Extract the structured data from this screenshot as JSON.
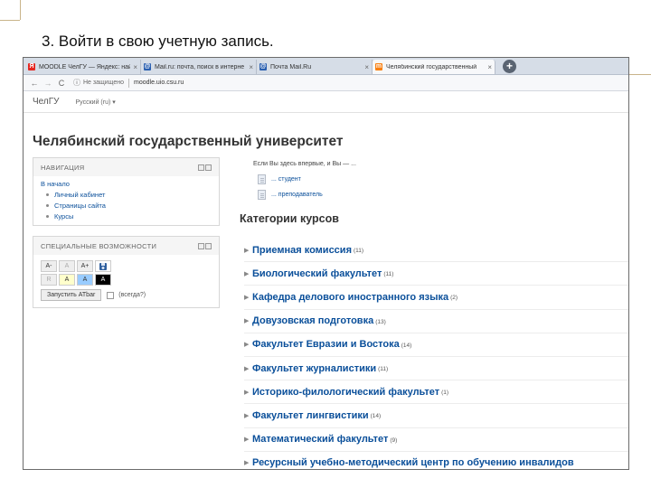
{
  "slide": {
    "title": "3. Войти в свою учетную запись."
  },
  "browser": {
    "tabs": [
      {
        "favicon": "Я",
        "favicon_color": "#e52620",
        "title": "MOODLE ЧелГУ — Яндекс: най",
        "active": false
      },
      {
        "favicon": "@",
        "favicon_color": "#2a5fb0",
        "title": "Mail.ru: почта, поиск в интерне",
        "active": false
      },
      {
        "favicon": "@",
        "favicon_color": "#2a5fb0",
        "title": "Почта Mail.Ru",
        "active": false
      },
      {
        "favicon": "m",
        "favicon_color": "#f98012",
        "title": "Челябинский государственный",
        "active": true
      }
    ],
    "close_glyph": "×",
    "new_tab_glyph": "+",
    "back_glyph": "←",
    "forward_glyph": "→",
    "reload_glyph": "C",
    "info_glyph": "ⓘ",
    "security_label": "Не защищено",
    "url": "moodle.uio.csu.ru"
  },
  "site": {
    "brand": "ЧелГУ",
    "language": "Русский (ru) ▾",
    "page_title": "Челябинский государственный университет"
  },
  "navigation_block": {
    "heading": "НАВИГАЦИЯ",
    "home": "В начало",
    "items": [
      "Личный кабинет",
      "Страницы сайта",
      "Курсы"
    ]
  },
  "accessibility_block": {
    "heading": "СПЕЦИАЛЬНЫЕ ВОЗМОЖНОСТИ",
    "row1": [
      {
        "label": "A-",
        "bg": "#eeeeee",
        "fg": "#333333"
      },
      {
        "label": "A",
        "bg": "#eeeeee",
        "fg": "#aaaaaa"
      },
      {
        "label": "A+",
        "bg": "#eeeeee",
        "fg": "#333333"
      },
      {
        "label": "",
        "bg": "#ffffff",
        "fg": "#333333",
        "icon": "save-icon"
      }
    ],
    "row2": [
      {
        "label": "R",
        "bg": "#eeeeee",
        "fg": "#aaaaaa"
      },
      {
        "label": "A",
        "bg": "#ffffcc",
        "fg": "#333333"
      },
      {
        "label": "A",
        "bg": "#99ccff",
        "fg": "#333333"
      },
      {
        "label": "A",
        "bg": "#000000",
        "fg": "#ffffff"
      }
    ],
    "atbar_button": "Запустить ATbar",
    "always_label": "(всегда?)"
  },
  "main": {
    "welcome": "Если Вы здесь впервые, и Вы — ...",
    "roles": [
      "... студент",
      "... преподаватель"
    ],
    "categories_heading": "Категории курсов",
    "categories": [
      {
        "name": "Приемная комиссия",
        "count": "(11)"
      },
      {
        "name": "Биологический факультет",
        "count": "(11)"
      },
      {
        "name": "Кафедра делового иностранного языка",
        "count": "(2)"
      },
      {
        "name": "Довузовская подготовка",
        "count": "(13)"
      },
      {
        "name": "Факультет Евразии и Востока",
        "count": "(14)"
      },
      {
        "name": "Факультет журналистики",
        "count": "(11)"
      },
      {
        "name": "Историко-филологический факультет",
        "count": "(1)"
      },
      {
        "name": "Факультет лингвистики",
        "count": "(14)"
      },
      {
        "name": "Математический факультет",
        "count": "(9)"
      },
      {
        "name": "Ресурсный учебно-методический центр по обучению инвалидов",
        "count": ""
      }
    ]
  }
}
